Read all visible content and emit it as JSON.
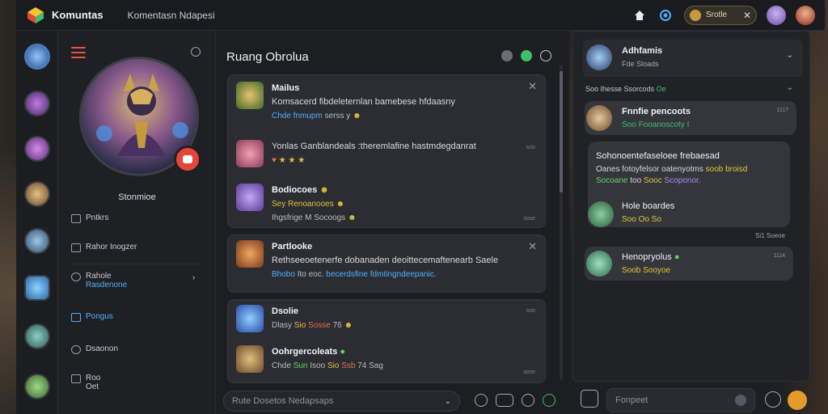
{
  "app": {
    "brand": "Komuntas",
    "subtitle": "Komentasn Ndapesi",
    "profile_pill_name": "Srotle",
    "profile_pill_close": "✕"
  },
  "sidebar": {
    "player_name": "Stonmioe",
    "items": [
      {
        "label": "Pntkrs"
      },
      {
        "label": "Rahor Inogzer"
      },
      {
        "label": "Rahole",
        "sublabel": "Rasdenone"
      },
      {
        "label": "Pongus"
      },
      {
        "label": "Dsaonon"
      },
      {
        "label": "Roo",
        "sublabel": "Oet"
      }
    ],
    "active_index": 3
  },
  "chat": {
    "title": "Ruang Obrolua",
    "composer_placeholder": "Rute Dosetos Nedapsaps",
    "cards": [
      {
        "close": "✕",
        "messages": [
          {
            "name": "Mailus",
            "line1": "Komsacerd fibdeleternlan  bamebese hfdaasny",
            "line2": "Chde fnmupm",
            "line2b": "serss y",
            "stamp": ""
          },
          {
            "name": "Yonlas Ganblandeals :theremlafine hastmdegdanrat",
            "line1": "",
            "line2": "★ ★ ★",
            "stamp": "soo"
          },
          {
            "name": "Bodiocoes",
            "line1": "Sey Renoanooes",
            "line2": "Ihgsfrige M Socoogs",
            "stamp": "sose"
          }
        ]
      },
      {
        "close": "✕",
        "messages": [
          {
            "name": "Partlooke",
            "line1": "Rethseeoetenerfe dobanaden  deoittecemaftenearb  Saele",
            "line2a": "Bhobo",
            "line2b": "Ito eoc.",
            "line2c": "becerdsfine fdmtingndeepanic.",
            "stamp": ""
          }
        ]
      },
      {
        "close": "",
        "messages": [
          {
            "name": "Dsolie",
            "line1a": "Dlasy",
            "line1b": "Sio",
            "line1c": "Sosse",
            "line1d": "76",
            "stamp": "soo"
          },
          {
            "name": "Oohrgercoleats",
            "line1a": "Chde",
            "line1b": "Sun",
            "line1c": "Isoo",
            "line1d": "Sio",
            "line1e": "Ssb",
            "line1f": "74 Sag",
            "stamp": "sose"
          }
        ]
      }
    ]
  },
  "right": {
    "header_title": "Adhfamis",
    "header_sub": "Fde Sloads",
    "section_label": "Soo Ihesse Ssorcods",
    "section_tag": "Oe",
    "bubbles": [
      {
        "name": "Fnnfie pencoots",
        "text": "Soo Fooanoscoty I",
        "ts": "1117"
      },
      {
        "name": "Sohonoentefaseloee frebaesad",
        "text1": "Oanes fotoyfelsor  oatenyotms",
        "text1b": "soob broisd",
        "text2a": "Socoane",
        "text2b": "too",
        "text2c": "Sooc",
        "text2d": "Scoponor.",
        "name2": "Hole boardes",
        "text3": "Soo Oo So",
        "ts": ""
      },
      {
        "name": "Henopryolus",
        "text": "Soob Sooyoe",
        "ts": "1114"
      }
    ],
    "stamp": "Si1 Soeoe",
    "composer_placeholder": "Fonpeet"
  },
  "colors": {
    "accent_blue": "#4fb0ff",
    "accent_red": "#e5453b",
    "accent_green": "#3fbf6a",
    "accent_yellow": "#e2c43a"
  }
}
